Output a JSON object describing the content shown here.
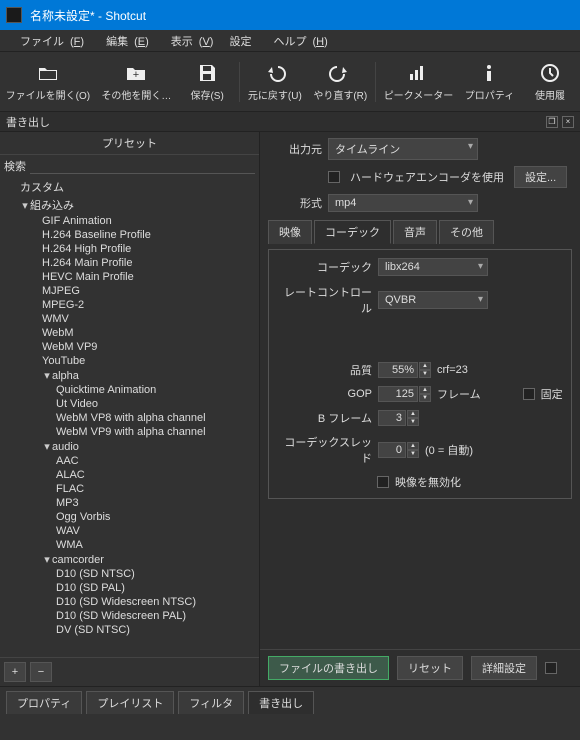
{
  "window": {
    "title": "名称未設定* - Shotcut"
  },
  "menu": {
    "file": {
      "label": "ファイル",
      "accel": "F"
    },
    "edit": {
      "label": "編集",
      "accel": "E"
    },
    "view": {
      "label": "表示",
      "accel": "V"
    },
    "settings": {
      "label": "設定"
    },
    "help": {
      "label": "ヘルプ",
      "accel": "H"
    }
  },
  "toolbar": {
    "open": {
      "label": "ファイルを開く(O)"
    },
    "openother": {
      "label": "その他を開く…"
    },
    "save": {
      "label": "保存(S)"
    },
    "undo": {
      "label": "元に戻す(U)"
    },
    "redo": {
      "label": "やり直す(R)"
    },
    "peak": {
      "label": "ピークメーター"
    },
    "props": {
      "label": "プロパティ"
    },
    "recent": {
      "label": "使用履"
    }
  },
  "panel": {
    "export_title": "書き出し"
  },
  "preset": {
    "header": "プリセット",
    "search_label": "検索",
    "add_label": "+",
    "remove_label": "−",
    "tree": [
      {
        "lv": 1,
        "label": "カスタム"
      },
      {
        "lv": 1,
        "expand": true,
        "label": "組み込み"
      },
      {
        "lv": 2,
        "label": "GIF Animation"
      },
      {
        "lv": 2,
        "label": "H.264 Baseline Profile"
      },
      {
        "lv": 2,
        "label": "H.264 High Profile"
      },
      {
        "lv": 2,
        "label": "H.264 Main Profile"
      },
      {
        "lv": 2,
        "label": "HEVC Main Profile"
      },
      {
        "lv": 2,
        "label": "MJPEG"
      },
      {
        "lv": 2,
        "label": "MPEG-2"
      },
      {
        "lv": 2,
        "label": "WMV"
      },
      {
        "lv": 2,
        "label": "WebM"
      },
      {
        "lv": 2,
        "label": "WebM VP9"
      },
      {
        "lv": 2,
        "label": "YouTube"
      },
      {
        "lv": 2,
        "expand": true,
        "label": "alpha"
      },
      {
        "lv": 3,
        "label": "Quicktime Animation"
      },
      {
        "lv": 3,
        "label": "Ut Video"
      },
      {
        "lv": 3,
        "label": "WebM VP8 with alpha channel"
      },
      {
        "lv": 3,
        "label": "WebM VP9 with alpha channel"
      },
      {
        "lv": 2,
        "expand": true,
        "label": "audio"
      },
      {
        "lv": 3,
        "label": "AAC"
      },
      {
        "lv": 3,
        "label": "ALAC"
      },
      {
        "lv": 3,
        "label": "FLAC"
      },
      {
        "lv": 3,
        "label": "MP3"
      },
      {
        "lv": 3,
        "label": "Ogg Vorbis"
      },
      {
        "lv": 3,
        "label": "WAV"
      },
      {
        "lv": 3,
        "label": "WMA"
      },
      {
        "lv": 2,
        "expand": true,
        "label": "camcorder"
      },
      {
        "lv": 3,
        "label": "D10 (SD NTSC)"
      },
      {
        "lv": 3,
        "label": "D10 (SD PAL)"
      },
      {
        "lv": 3,
        "label": "D10 (SD Widescreen NTSC)"
      },
      {
        "lv": 3,
        "label": "D10 (SD Widescreen PAL)"
      },
      {
        "lv": 3,
        "label": "DV (SD NTSC)"
      }
    ]
  },
  "form": {
    "source_label": "出力元",
    "source_value": "タイムライン",
    "hw_label": "ハードウェアエンコーダを使用",
    "hw_settings": "設定...",
    "format_label": "形式",
    "format_value": "mp4",
    "tabs": {
      "video": "映像",
      "codec": "コーデック",
      "audio": "音声",
      "other": "その他"
    },
    "codec": {
      "label": "コーデック",
      "value": "libx264",
      "rc_label": "レートコントロール",
      "rc_value": "QVBR",
      "quality_label": "品質",
      "quality_value": "55%",
      "crf_label": "crf=23",
      "gop_label": "GOP",
      "gop_value": "125",
      "gop_unit": "フレーム",
      "fixed_label": "固定",
      "bframes_label": "B フレーム",
      "bframes_value": "3",
      "threads_label": "コーデックスレッド",
      "threads_value": "0",
      "threads_hint": "(0 = 自動)",
      "disable_video_label": "映像を無効化"
    }
  },
  "actions": {
    "export_file": "ファイルの書き出し",
    "reset": "リセット",
    "advanced": "詳細設定"
  },
  "bottom_tabs": {
    "properties": "プロパティ",
    "playlist": "プレイリスト",
    "filters": "フィルタ",
    "export": "書き出し"
  }
}
